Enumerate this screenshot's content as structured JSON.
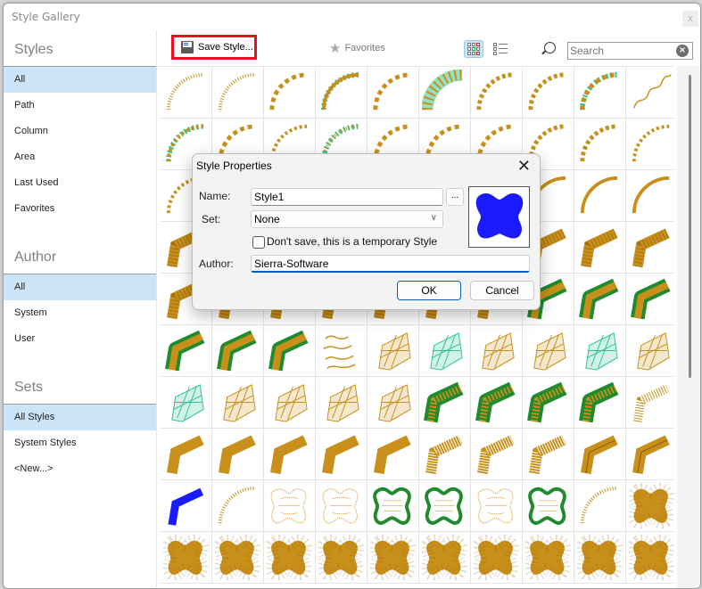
{
  "window": {
    "title": "Style Gallery",
    "close_label": "x"
  },
  "sidebar": {
    "sections": [
      {
        "heading": "Styles",
        "items": [
          {
            "label": "All",
            "selected": true
          },
          {
            "label": "Path",
            "selected": false
          },
          {
            "label": "Column",
            "selected": false
          },
          {
            "label": "Area",
            "selected": false
          },
          {
            "label": "Last Used",
            "selected": false
          },
          {
            "label": "Favorites",
            "selected": false
          }
        ]
      },
      {
        "heading": "Author",
        "items": [
          {
            "label": "All",
            "selected": true
          },
          {
            "label": "System",
            "selected": false
          },
          {
            "label": "User",
            "selected": false
          }
        ]
      },
      {
        "heading": "Sets",
        "items": [
          {
            "label": "All Styles",
            "selected": true
          },
          {
            "label": "System Styles",
            "selected": false
          },
          {
            "label": "<New...>",
            "selected": false
          }
        ]
      }
    ]
  },
  "toolbar": {
    "save_label": "Save Style...",
    "favorites_label": "Favorites",
    "view_mode": "grid",
    "search": {
      "value": "",
      "placeholder": "Search"
    }
  },
  "gallery": {
    "colors": {
      "gold": "#c8901a",
      "green": "#1f8a2e",
      "teal": "#2ec48e",
      "blue": "#1a1aff"
    },
    "rows": [
      [
        "arc-satin-teeth",
        "arc-comb",
        "arc-stars",
        "arc-teal-fern",
        "arc-cross",
        "arc-mesh",
        "arc-blocks",
        "arc-hooks",
        "arc-teal-cross",
        "wave-line"
      ],
      [
        "arc-teal-dots",
        "arc-diamonds",
        "arc-chain",
        "arc-teal-fringe",
        "arc-hearts",
        "arc-figures",
        "arc-pentagons",
        "arc-triangles",
        "arc-dashes",
        "arc-beads"
      ],
      [
        "arc-braid",
        "arc-fringe-satin",
        "arc-satin",
        "arc-satin",
        "arc-satin",
        "arc-satin",
        "arc-satin",
        "arc-greek",
        "arc-satin",
        "arc-satin"
      ],
      [
        "bend-zigzag",
        "bend-wave",
        "bend-diag",
        "bend-fill",
        "bend-fill",
        "bend-fill",
        "bend-fill",
        "bend-fill",
        "bend-ribbed",
        "bend-weave"
      ],
      [
        "bend-satin",
        "bend-satin",
        "bend-satin",
        "bend-satin",
        "bend-satin",
        "bend-satin",
        "bend-satin",
        "bend-green-spiky",
        "bend-green-fringe",
        "bend-green-border"
      ],
      [
        "bend-green-star",
        "bend-green-scallop",
        "bend-green-double",
        "wave-lines",
        "mesh-gold",
        "mesh-teal",
        "mesh-gold",
        "mesh-gold",
        "mesh-teal-net",
        "mesh-gold"
      ],
      [
        "grid-teal",
        "grid-gold",
        "grid-gold-dense",
        "lace-gold",
        "grid-gold-fan",
        "bend-green-net",
        "bend-green-net",
        "bend-green-net",
        "bend-green-net-teal",
        "zigzag-bend"
      ],
      [
        "bend-solid",
        "bend-solid",
        "bend-solid",
        "bend-solid",
        "bend-solid",
        "bend-fringe",
        "bend-fringe",
        "bend-tatami",
        "bend-double",
        "bend-triple"
      ],
      [
        "bend-blue",
        "arch-fringe",
        "bone-contour",
        "bone-contour",
        "bone-green",
        "bone-green",
        "bone-lines",
        "bone-green-lines",
        "arch-fringe",
        "bone-fill"
      ],
      [
        "bone-fill",
        "bone-fill",
        "bone-fill",
        "bone-fill",
        "bone-fill",
        "bone-fill",
        "bone-fill",
        "bone-fill",
        "bone-fill",
        "bone-fill"
      ]
    ]
  },
  "dialog": {
    "title": "Style Properties",
    "name_label": "Name:",
    "name_value": "Style1",
    "browse_label": "...",
    "set_label": "Set:",
    "set_value": "None",
    "temp_checkbox_label": "Don't save, this is a temporary Style",
    "temp_checked": false,
    "author_label": "Author:",
    "author_value": "Sierra-Software",
    "ok_label": "OK",
    "cancel_label": "Cancel",
    "preview_color": "#1a1aff"
  }
}
